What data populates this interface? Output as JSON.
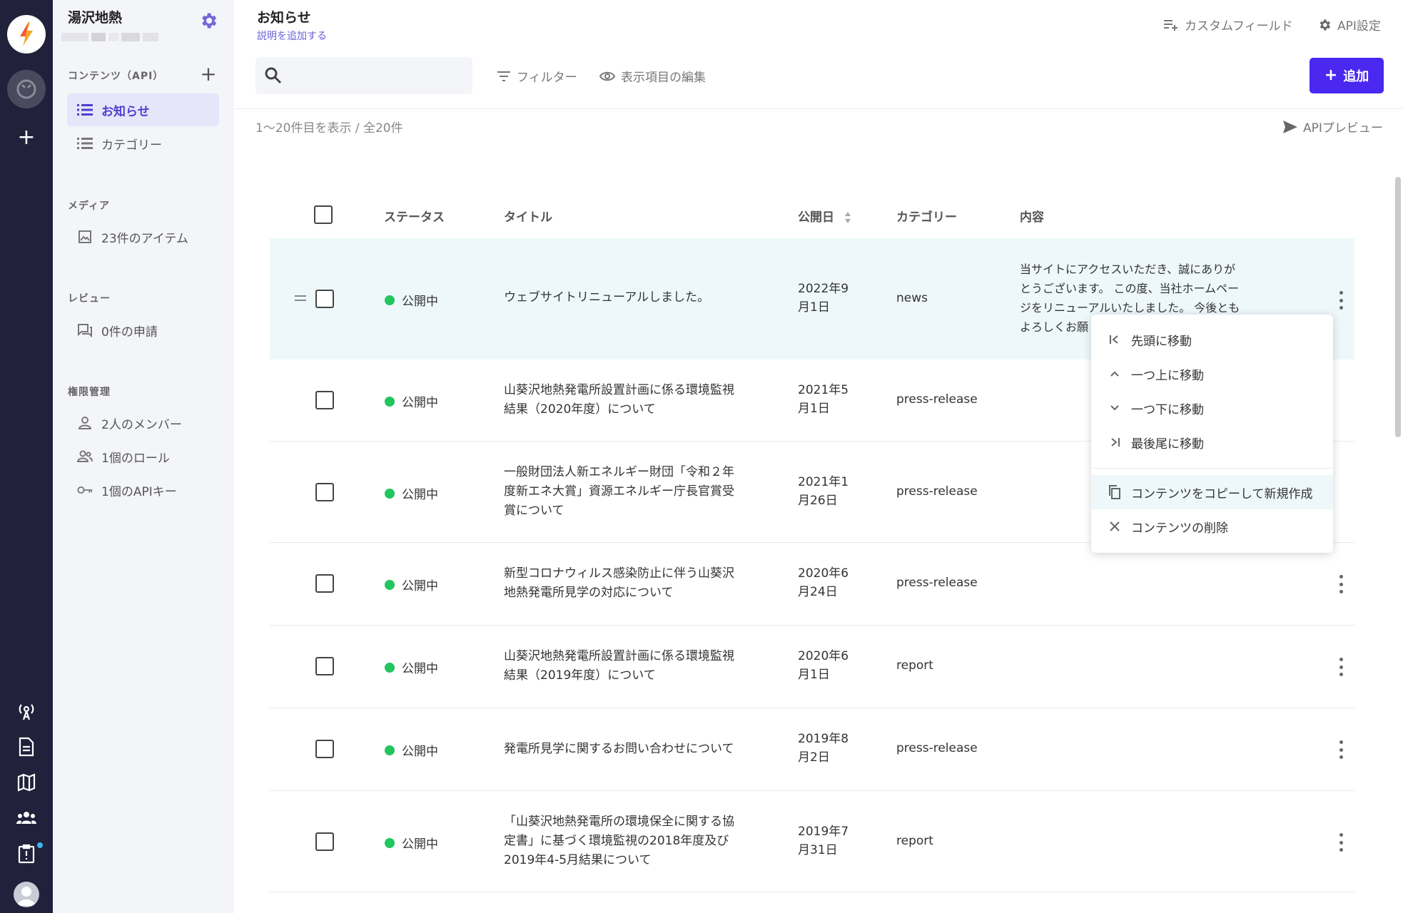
{
  "workspace": {
    "name": "湯沢地熱"
  },
  "sidebar": {
    "content_section": "コンテンツ（API）",
    "content_items": [
      {
        "label": "お知らせ",
        "active": true
      },
      {
        "label": "カテゴリー",
        "active": false
      }
    ],
    "media_section": "メディア",
    "media_item": "23件のアイテム",
    "review_section": "レビュー",
    "review_item": "0件の申請",
    "perm_section": "権限管理",
    "perm_items": [
      "2人のメンバー",
      "1個のロール",
      "1個のAPIキー"
    ]
  },
  "header": {
    "title": "お知らせ",
    "description": "説明を追加する",
    "custom_fields": "カスタムフィールド",
    "api_settings": "API設定"
  },
  "toolbar": {
    "search_placeholder": "",
    "filter": "フィルター",
    "edit_columns": "表示項目の編集",
    "add": "追加"
  },
  "list_info": {
    "count": "1〜20件目を表示 / 全20件",
    "api_preview": "APIプレビュー"
  },
  "table": {
    "columns": [
      "ステータス",
      "タイトル",
      "公開日",
      "カテゴリー",
      "内容"
    ],
    "rows": [
      {
        "status": "公開中",
        "title": [
          "ウェブサイトリニューアルしました。"
        ],
        "date": [
          "2022年9",
          "月1日"
        ],
        "category": "news",
        "content": [
          "当サイトにアクセスいただき、誠にありが",
          "とうございます。 この度、当社ホームペー",
          "ジをリニューアルいたしました。 今後とも",
          "よろしくお願"
        ]
      },
      {
        "status": "公開中",
        "title": [
          "山葵沢地熱発電所設置計画に係る環境監視",
          "結果（2020年度）について"
        ],
        "date": [
          "2021年5",
          "月1日"
        ],
        "category": "press-release",
        "content": []
      },
      {
        "status": "公開中",
        "title": [
          "一般財団法人新エネルギー財団「令和２年",
          "度新エネ大賞」資源エネルギー庁長官賞受",
          "賞について"
        ],
        "date": [
          "2021年1",
          "月26日"
        ],
        "category": "press-release",
        "content": []
      },
      {
        "status": "公開中",
        "title": [
          "新型コロナウィルス感染防止に伴う山葵沢",
          "地熱発電所見学の対応について"
        ],
        "date": [
          "2020年6",
          "月24日"
        ],
        "category": "press-release",
        "content": []
      },
      {
        "status": "公開中",
        "title": [
          "山葵沢地熱発電所設置計画に係る環境監視",
          "結果（2019年度）について"
        ],
        "date": [
          "2020年6",
          "月1日"
        ],
        "category": "report",
        "content": []
      },
      {
        "status": "公開中",
        "title": [
          "発電所見学に関するお問い合わせについて"
        ],
        "date": [
          "2019年8",
          "月2日"
        ],
        "category": "press-release",
        "content": []
      },
      {
        "status": "公開中",
        "title": [
          "「山葵沢地熱発電所の環境保全に関する協",
          "定書」に基づく環境監視の2018年度及び",
          "2019年4-5月結果について"
        ],
        "date": [
          "2019年7",
          "月31日"
        ],
        "category": "report",
        "content": []
      }
    ]
  },
  "context_menu": {
    "items": [
      "先頭に移動",
      "一つ上に移動",
      "一つ下に移動",
      "最後尾に移動",
      "コンテンツをコピーして新規作成",
      "コンテンツの削除"
    ]
  },
  "colors": {
    "rail": "#21213b",
    "accent": "#4a28f0",
    "status_green": "#22c55e",
    "active_item_bg": "#e6e5f9"
  }
}
